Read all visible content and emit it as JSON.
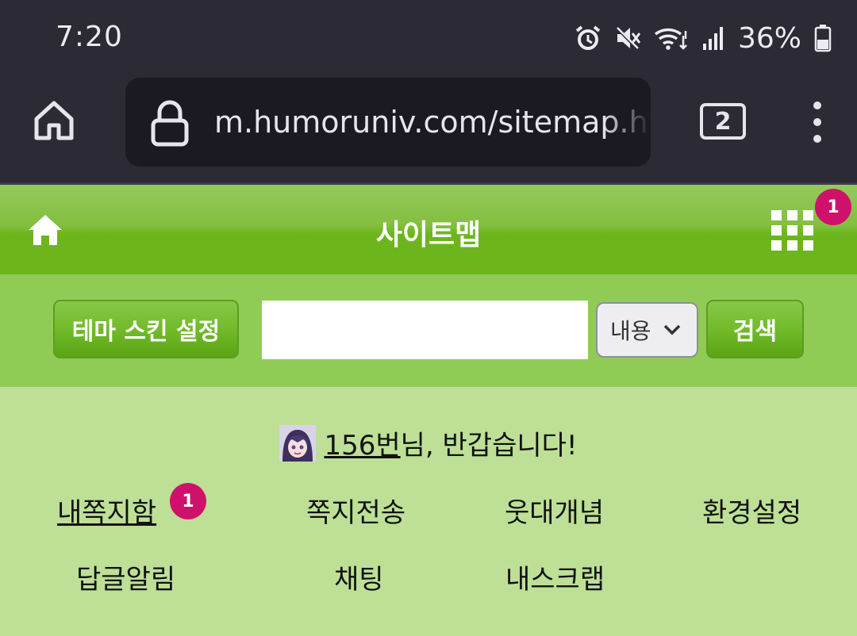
{
  "status_bar": {
    "time": "7:20",
    "battery_percent": "36%",
    "icons": [
      "alarm-icon",
      "mute-icon",
      "wifi-icon",
      "signal-icon",
      "battery-icon"
    ]
  },
  "browser": {
    "url": "m.humoruniv.com/sitemap.html",
    "tab_count": "2",
    "icons": [
      "home-icon",
      "lock-icon",
      "tabs-icon",
      "more-icon"
    ]
  },
  "header": {
    "title": "사이트맵",
    "notification_count": "1"
  },
  "search": {
    "theme_button_label": "테마 스킨 설정",
    "input_value": "",
    "scope_selected": "내용",
    "search_button_label": "검색"
  },
  "welcome": {
    "username": "156번",
    "greeting_suffix": "님, 반갑습니다!"
  },
  "menu": {
    "inbox": "내쪽지함",
    "inbox_badge": "1",
    "send_message": "쪽지전송",
    "humor_concept": "웃대개념",
    "settings": "환경설정",
    "reply_alerts": "답글알림",
    "chat": "채팅",
    "my_scrap": "내스크랩"
  },
  "colors": {
    "status_bar_bg": "#2b2a35",
    "header_green": "#6cb51c",
    "search_row_green": "#90cc55",
    "content_bg": "#bde096",
    "badge": "#d0116b"
  }
}
